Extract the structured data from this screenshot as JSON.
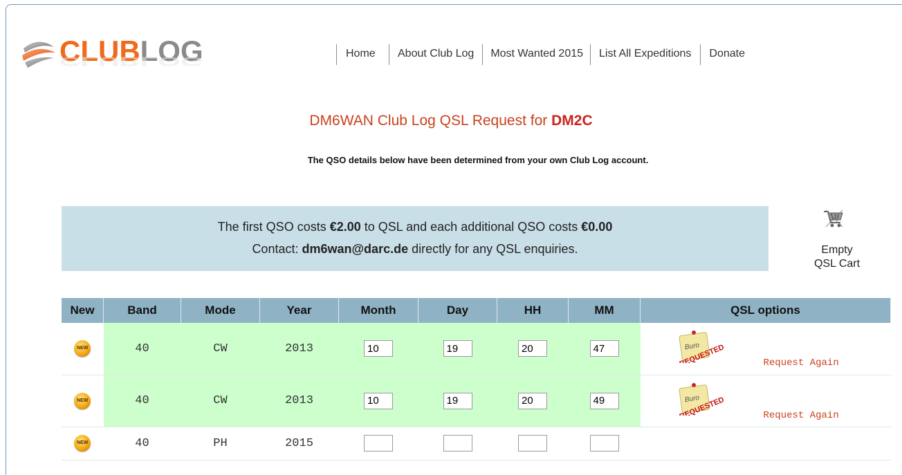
{
  "logo": {
    "part1": "CLUB",
    "part2": "LOG"
  },
  "nav": [
    "Home",
    "About Club Log",
    "Most Wanted 2015",
    "List All Expeditions",
    "Donate"
  ],
  "title": {
    "prefix": "DM6WAN Club Log QSL Request for ",
    "callsign": "DM2C"
  },
  "subtitle": "The QSO details below have been determined from your own Club Log account.",
  "info": {
    "line1_a": "The first QSO costs ",
    "line1_b": "€2.00",
    "line1_c": " to QSL and each additional QSO costs ",
    "line1_d": "€0.00",
    "line2_a": "Contact: ",
    "line2_b": "dm6wan@darc.de",
    "line2_c": " directly for any QSL enquiries."
  },
  "cart": {
    "line1": "Empty",
    "line2": "QSL Cart"
  },
  "table": {
    "headers": [
      "New",
      "Band",
      "Mode",
      "Year",
      "Month",
      "Day",
      "HH",
      "MM",
      "QSL options"
    ],
    "new_badge": "NEW",
    "rows": [
      {
        "band": "40",
        "mode": "CW",
        "year": "2013",
        "month": "10",
        "day": "19",
        "hh": "20",
        "mm": "47",
        "stamp": "BURO REQUESTED",
        "action": "Request Again"
      },
      {
        "band": "40",
        "mode": "CW",
        "year": "2013",
        "month": "10",
        "day": "19",
        "hh": "20",
        "mm": "49",
        "stamp": "BURO REQUESTED",
        "action": "Request Again"
      },
      {
        "band": "40",
        "mode": "PH",
        "year": "2015",
        "month": "",
        "day": "",
        "hh": "",
        "mm": "",
        "stamp": "",
        "action": ""
      }
    ]
  },
  "colors": {
    "accent": "#c8421e",
    "header_bg": "#8fb3c4",
    "info_bg": "#c9dfe8",
    "row_green": "#ccffcc"
  }
}
